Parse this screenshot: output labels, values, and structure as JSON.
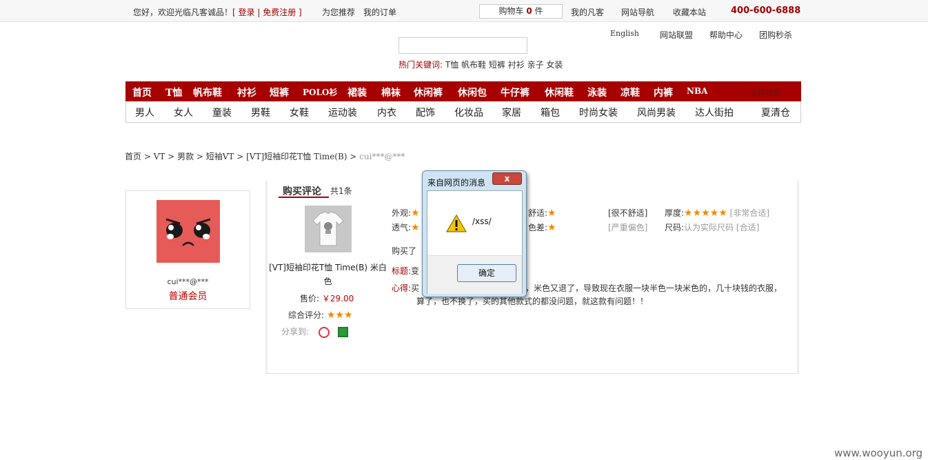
{
  "topbar": {
    "welcome": "您好，欢迎光临凡客诚品！",
    "login": "登录",
    "register": "免费注册",
    "recommend": "为您推荐",
    "my_orders": "我的订单",
    "cart_label": "购物车",
    "cart_count": "0",
    "cart_unit": "件",
    "my_vancl": "我的凡客",
    "site_nav": "网站导航",
    "favorite": "收藏本站",
    "phone": "400-600-6888"
  },
  "sublinks": [
    "English",
    "网站联盟",
    "帮助中心",
    "团购秒杀"
  ],
  "search": {
    "value": ""
  },
  "hot": {
    "label": "热门关键词:",
    "keywords": [
      "T恤",
      "帆布鞋",
      "短裤",
      "衬衫",
      "亲子",
      "女装"
    ]
  },
  "nav_main": [
    "首页",
    "T恤",
    "帆布鞋",
    "衬衫",
    "短裤",
    "POLO衫",
    "裙装",
    "棉袜",
    "休闲裤",
    "休闲包",
    "牛仔裤",
    "休闲鞋",
    "泳装",
    "凉鞋",
    "内裤",
    "NBA",
    "品牌频道"
  ],
  "nav_sub": [
    "男人",
    "女人",
    "童装",
    "男鞋",
    "女鞋",
    "运动装",
    "内衣",
    "配饰",
    "化妆品",
    "家居",
    "箱包",
    "时尚女装",
    "风尚男装",
    "达人街拍",
    "夏清仓"
  ],
  "breadcrumb": [
    "首页",
    "VT",
    "男款",
    "短袖VT",
    "[VT]短袖印花T恤 Time(B)",
    "cui***@***"
  ],
  "user": {
    "name": "cui***@***",
    "level": "普通会员"
  },
  "review": {
    "tab_title": "购买评论",
    "tab_count": "共1条",
    "product_name": "[VT]短袖印花T恤 Time(B) 米白色",
    "price_label": "售价:",
    "price": "￥29.00",
    "rating_label": "综合评分:",
    "rating": 3,
    "share_label": "分享到:",
    "attr_appearance": "外观:",
    "attr_breath": "透气:",
    "attr_comfort": "舒适:",
    "attr_comfort_val": "[很不舒适]",
    "attr_color": "色差:",
    "attr_color_val": "[严重偏色]",
    "attr_thick": "厚度:",
    "attr_thick_val": "[非常合适]",
    "attr_size": "尺码:",
    "attr_size_val": "认为实际尺码",
    "attr_size_val2": "[合适]",
    "bought": "购买了",
    "subject_label": "标题:",
    "subject_text": "变",
    "content_label": "心得:",
    "content_line1_a": "买",
    "content_line1_b": "，米色又退了，导致现在衣服一块半色一块米色的，几十块钱的衣服，",
    "content_line2": "算了，也不换了，买的其他款式的都没问题，就这款有问题！！"
  },
  "dialog": {
    "title": "来自网页的消息",
    "close": "x",
    "message": "/xss/",
    "ok": "确定"
  },
  "watermark": "www.wooyun.org"
}
